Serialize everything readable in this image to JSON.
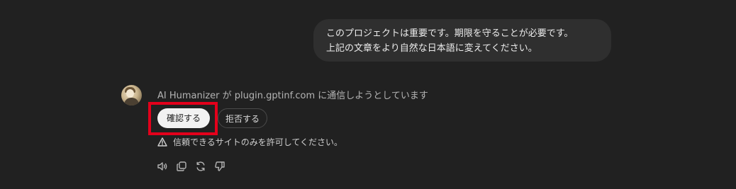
{
  "user_message": {
    "line1": "このプロジェクトは重要です。期限を守ることが必要です。",
    "line2": "上記の文章をより自然な日本語に変えてください。"
  },
  "assistant": {
    "avatar_icon": "ai-humanizer-avatar",
    "status": "AI Humanizer が plugin.gptinf.com に通信しようとしています",
    "confirm_label": "確認する",
    "deny_label": "拒否する",
    "warning_text": "信頼できるサイトのみを許可してください。",
    "warning_icon": "warning-triangle-icon",
    "actions": [
      "speaker-icon",
      "copy-icon",
      "regenerate-icon",
      "thumbs-down-icon"
    ]
  },
  "colors": {
    "background": "#212121",
    "bubble": "#2f2f2f",
    "highlight": "#e3001b",
    "confirm_bg": "#f2f2f2"
  }
}
